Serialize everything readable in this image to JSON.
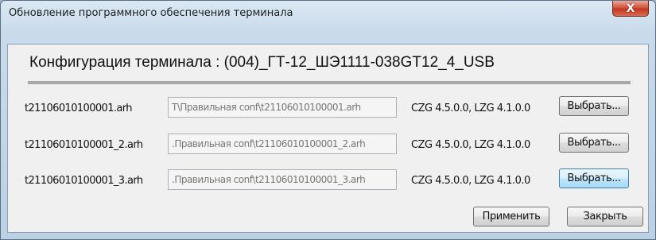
{
  "window": {
    "title": "Обновление программного обеспечения терминала",
    "close_symbol": "X"
  },
  "header": {
    "title": "Конфигурация терминала : (004)_ГТ-12_ШЭ1111-038GT12_4_USB"
  },
  "files": [
    {
      "name": "t21106010100001.arh",
      "path": "T\\Правильная conf\\t21106010100001.arh",
      "versions": "CZG 4.5.0.0, LZG 4.1.0.0",
      "button_label": "Выбрать..."
    },
    {
      "name": "t21106010100001_2.arh",
      "path": ".Правильная conf\\t21106010100001_2.arh",
      "versions": "CZG 4.5.0.0, LZG 4.1.0.0",
      "button_label": "Выбрать..."
    },
    {
      "name": "t21106010100001_3.arh",
      "path": ".Правильная conf\\t21106010100001_3.arh",
      "versions": "CZG 4.5.0.0, LZG 4.1.0.0",
      "button_label": "Выбрать..."
    }
  ],
  "actions": {
    "apply_label": "Применить",
    "close_label": "Закрыть"
  },
  "colors": {
    "title_close": "#c9472f",
    "focus_button": "#bee6fd"
  }
}
